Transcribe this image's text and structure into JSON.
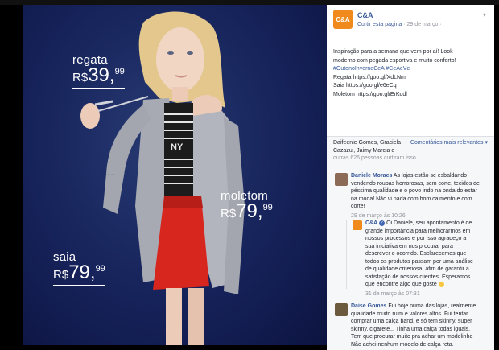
{
  "colors": {
    "photo_background": "#16225a",
    "brand_avatar": "#f08a1c",
    "link": "#365899",
    "page_name": "#3b5998",
    "muted_text": "#90949c",
    "comment_bg": "#f6f7f9"
  },
  "photo": {
    "products": [
      {
        "label": "regata",
        "currency": "R$",
        "amount": "39",
        "cents": "99"
      },
      {
        "label": "moletom",
        "currency": "R$",
        "amount": "79",
        "cents": "99"
      },
      {
        "label": "saia",
        "currency": "R$",
        "amount": "79",
        "cents": "99"
      }
    ]
  },
  "post": {
    "avatar_text": "C&A",
    "page_name": "C&A",
    "like_page_link": "Curtir esta página",
    "date": "· 29 de março ·",
    "chevron_icon": "chevron-down-icon",
    "lines": [
      "Inspiração para a semana que vem por aí! Look",
      "moderno com pegada esportiva e muito conforto!",
      "#OutonoInvernoCeA #CeAeVc",
      "Regata https://goo.gl/XdLNm",
      "Saia https://goo.gl/e6eCq",
      "Moletom https://goo.gl/ErKodl"
    ]
  },
  "reactions": {
    "line1": "Daifeenie Gomes, Graciela",
    "line2": "Cazazul, Jaimy Marcia e",
    "others": "outras 626 pessoas curtiram isso.",
    "sort_link": "Comentários mais relevantes ▾"
  },
  "comments": [
    {
      "author": "Daniele Moraes",
      "text_lines": [
        "As lojas estão se esbaldando",
        "vendendo roupas horrorosas, sem corte, tecidos de",
        "péssima qualidade e o povo indo na onda do estar",
        "na moda! Não vi nada com bom caimento e com",
        "corte!"
      ],
      "time": "29 de março às 10:26"
    },
    {
      "author": "C&A",
      "text_lines": [
        "Oi Daniele, seu apontamento é de",
        "grande importância para melhorarmos em",
        "nossos processos e por isso agradeço a",
        "sua iniciativa em nos procurar para",
        "descrever o ocorrido. Esclarecemos que",
        "todos os produtos passam por uma análise",
        "de qualidade criteriosa, afim de garantir a",
        "satisfação de nossos clientes. Esperamos",
        "que encontre algo que goste"
      ],
      "time": "31 de março às 07:31"
    },
    {
      "author": "Daise Gomes",
      "text_lines": [
        "Fui hoje numa das lojas, realmente",
        "qualidade muito ruim e valores altos. Fui tentar",
        "comprar uma calça band, e só tem skinny, super",
        "skinny, cigarete... Tinha uma calça todas iguais.",
        "Tem que procurar muito pra achar um modelinho",
        "Não achei nenhum modelo de calça reta."
      ],
      "time": ""
    }
  ]
}
